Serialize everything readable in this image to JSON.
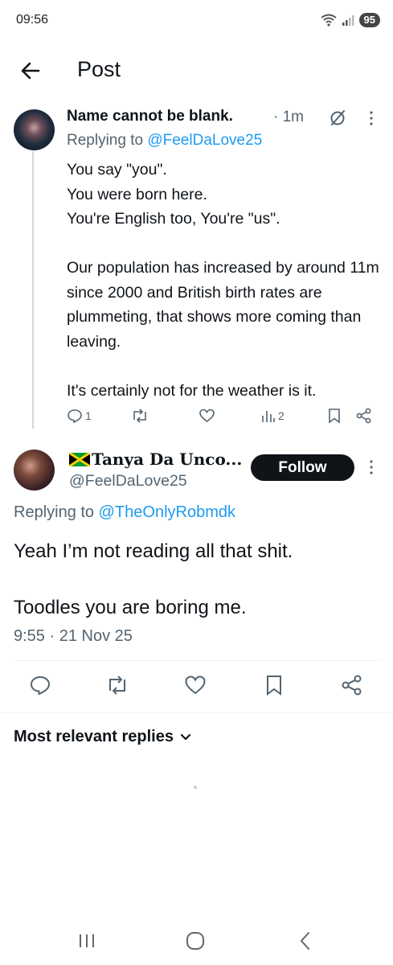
{
  "status_bar": {
    "time": "09:56",
    "battery": "95"
  },
  "header": {
    "title": "Post"
  },
  "reply": {
    "name": "Name cannot be blank.",
    "time": "· 1m",
    "replying_prefix": "Replying to ",
    "replying_to": "@FeelDaLove25",
    "body": "You say \"you\".\nYou were born here.\nYou're English too, You're \"us\".\n\nOur population has increased by around 11m since 2000 and British birth rates are plummeting, that shows more coming than leaving.\n\nIt's certainly not for the weather is it.",
    "stats": {
      "replies": "1",
      "views": "2"
    }
  },
  "post": {
    "name": "Tanya Da Unco...",
    "handle": "@FeelDaLove25",
    "follow_label": "Follow",
    "replying_prefix": "Replying to ",
    "replying_to": "@TheOnlyRobmdk",
    "body": "Yeah I’m not reading all that shit.\n\nToodles you are boring me.",
    "timestamp": "9:55 · 21 Nov 25"
  },
  "replies_sort": {
    "label": "Most relevant replies"
  },
  "icons": {
    "back": "arrow-left-icon",
    "grok": "grok-icon",
    "more": "more-vertical-icon",
    "reply": "comment-icon",
    "repost": "repost-icon",
    "like": "heart-icon",
    "views": "bar-chart-icon",
    "bookmark": "bookmark-icon",
    "share": "share-icon"
  },
  "colors": {
    "link": "#1d9bf0",
    "secondary_text": "#536471",
    "follow_bg": "#0f1419"
  }
}
